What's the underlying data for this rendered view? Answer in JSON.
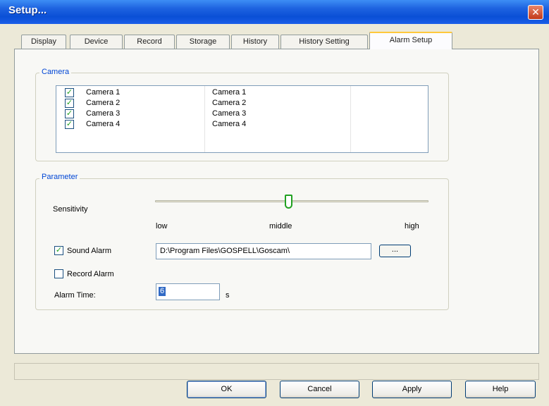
{
  "window": {
    "title": "Setup...",
    "close_glyph": "✕"
  },
  "tabs": [
    {
      "label": "Display"
    },
    {
      "label": "Device"
    },
    {
      "label": "Record"
    },
    {
      "label": "Storage"
    },
    {
      "label": "History"
    },
    {
      "label": "History Setting"
    },
    {
      "label": "Alarm Setup",
      "active": true
    }
  ],
  "camera_group": {
    "legend": "Camera",
    "rows": [
      {
        "name": "Camera 1",
        "alias": "Camera 1",
        "checked": true
      },
      {
        "name": "Camera 2",
        "alias": "Camera 2",
        "checked": true
      },
      {
        "name": "Camera 3",
        "alias": "Camera 3",
        "checked": true
      },
      {
        "name": "Camera 4",
        "alias": "Camera 4",
        "checked": true
      }
    ]
  },
  "parameter_group": {
    "legend": "Parameter",
    "sensitivity_label": "Sensitivity",
    "sensitivity_level": 0.5,
    "scale": {
      "low": "low",
      "middle": "middle",
      "high": "high"
    },
    "sound_alarm": {
      "label": "Sound Alarm",
      "checked": true,
      "path": "D:\\Program Files\\GOSPELL\\Goscam\\",
      "browse_label": "..."
    },
    "record_alarm": {
      "label": "Record Alarm",
      "checked": false
    },
    "alarm_time": {
      "label": "Alarm Time:",
      "value": "6",
      "unit": "s"
    }
  },
  "buttons": {
    "ok": "OK",
    "cancel": "Cancel",
    "apply": "Apply",
    "help": "Help"
  },
  "colors": {
    "titlebar": "#0a4fd6",
    "accent": "#0046d5",
    "check": "#21a121"
  }
}
